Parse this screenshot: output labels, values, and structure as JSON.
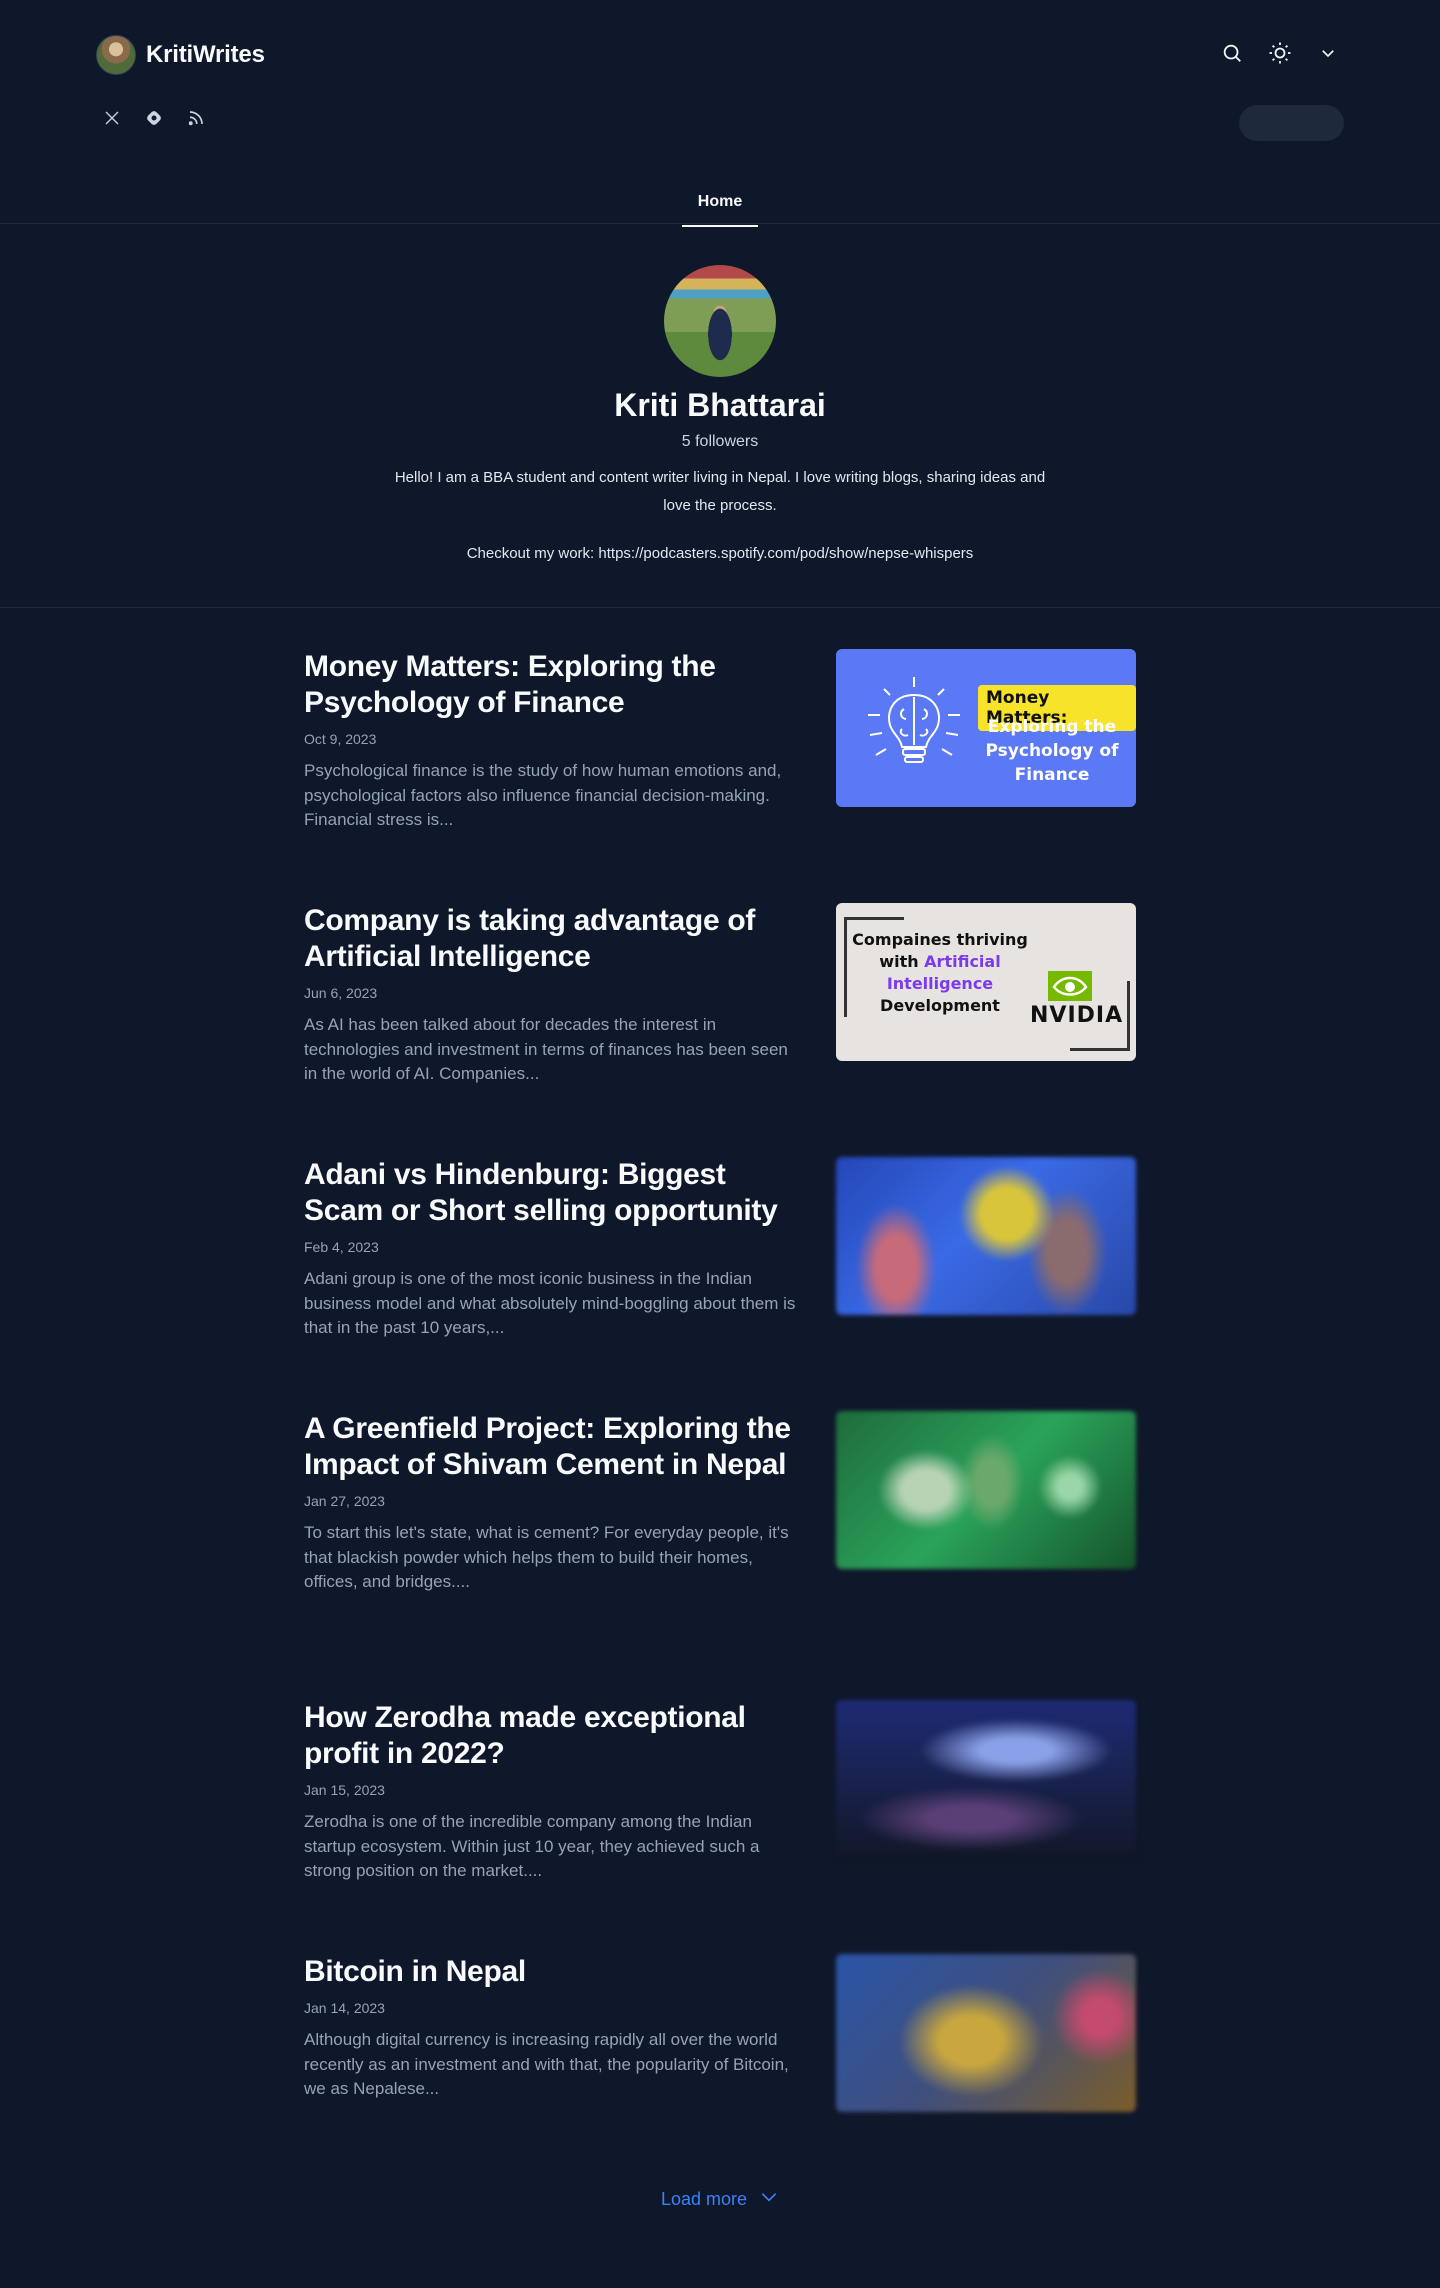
{
  "site": {
    "name": "KritiWrites",
    "avatar_icon": "author-photo",
    "header_icons": [
      "search-icon",
      "sun-icon",
      "chevron-down-icon"
    ],
    "social_icons": [
      "x-icon",
      "hashnode-icon",
      "rss-icon"
    ]
  },
  "nav": {
    "tabs": [
      {
        "label": "Home",
        "active": true
      }
    ]
  },
  "profile": {
    "name": "Kriti Bhattarai",
    "followers": "5 followers",
    "bio": "Hello! I am a BBA student and content writer living in Nepal. I love writing blogs, sharing ideas and love the process.",
    "link_text": "Checkout my work: https://podcasters.spotify.com/pod/show/nepse-whispers"
  },
  "posts": [
    {
      "title": "Money Matters: Exploring the Psychology of Finance",
      "date": "Oct 9, 2023",
      "excerpt": "Psychological finance is the study of how human emotions and, psychological factors also influence financial decision-making. Financial stress is...",
      "thumb": {
        "badge": "Money Matters:",
        "text": "Exploring the Psychology of Finance",
        "icon": "lightbulb-brain-icon"
      }
    },
    {
      "title": "Company is taking advantage of Artificial Intelligence",
      "date": "Jun 6, 2023",
      "excerpt": "As AI has been talked about for decades the interest in technologies and investment in terms of finances has been seen in the world of AI. Companies...",
      "thumb": {
        "line1": "Compaines thriving",
        "line2_a": "with ",
        "line2_b": "Artificial",
        "line3": "Intelligence",
        "line4": "Development",
        "logo_text": "NVIDIA",
        "icon": "nvidia-logo-icon"
      }
    },
    {
      "title": "Adani vs Hindenburg: Biggest Scam or Short selling opportunity",
      "date": "Feb 4, 2023",
      "excerpt": "Adani group is one of the most iconic business in the Indian business model and what absolutely mind-boggling about them is that in the past 10 years,..."
    },
    {
      "title": "A Greenfield Project: Exploring the Impact of Shivam Cement in Nepal",
      "date": "Jan 27, 2023",
      "excerpt": "To start this let's state, what is cement? For everyday people, it's that blackish powder which helps them to build their homes, offices, and bridges...."
    },
    {
      "title": "How Zerodha made exceptional profit in 2022?",
      "date": "Jan 15, 2023",
      "excerpt": "Zerodha is one of the incredible company among the Indian startup ecosystem. Within just 10 year, they achieved such a strong position on the market...."
    },
    {
      "title": "Bitcoin in Nepal",
      "date": "Jan 14, 2023",
      "excerpt": "Although digital currency is increasing rapidly all over the world recently as an investment and with that, the popularity of Bitcoin, we as Nepalese..."
    }
  ],
  "load_more": {
    "label": "Load more",
    "icon": "chevron-down-icon"
  },
  "colors": {
    "background": "#0f172a",
    "accent": "#3b82f6",
    "thumb_money_matters": "#5b78f5",
    "badge_yellow": "#f7e32a",
    "ai_purple": "#7c3aed"
  }
}
